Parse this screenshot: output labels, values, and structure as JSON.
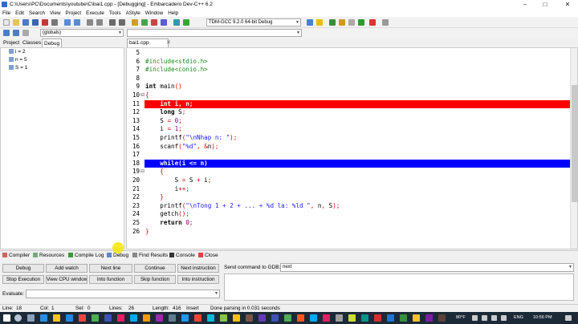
{
  "window": {
    "title": "C:\\Users\\PC\\Documents\\youtube\\C\\bai1.cpp - [Debugging] - Embarcadero Dev-C++ 6.2"
  },
  "menu": [
    "File",
    "Edit",
    "Search",
    "View",
    "Project",
    "Execute",
    "Tools",
    "AStyle",
    "Window",
    "Help"
  ],
  "toolbar": {
    "compiler_select": "TDM-GCC 9.2.0 64-bit Debug",
    "scope_select": "(globals)"
  },
  "left_tabs": [
    "Project",
    "Classes",
    "Debug"
  ],
  "watches": [
    "i = 2",
    "n = 5",
    "S = 1"
  ],
  "editor": {
    "tab_label": "bai1.cpp",
    "lines": [
      {
        "n": "5",
        "text": ""
      },
      {
        "n": "6",
        "text": "#include<stdio.h>"
      },
      {
        "n": "7",
        "text": "#include<conio.h>"
      },
      {
        "n": "8",
        "text": ""
      },
      {
        "n": "9",
        "text": "int main()"
      },
      {
        "n": "10",
        "text": "{"
      },
      {
        "n": "11",
        "text": "    int i, n;"
      },
      {
        "n": "12",
        "text": "    long S;"
      },
      {
        "n": "13",
        "text": "    S = 0;"
      },
      {
        "n": "14",
        "text": "    i = 1;"
      },
      {
        "n": "15",
        "text": "    printf(\"\\nNhap n: \");"
      },
      {
        "n": "16",
        "text": "    scanf(\"%d\", &n);"
      },
      {
        "n": "17",
        "text": ""
      },
      {
        "n": "18",
        "text": "    while(i <= n)"
      },
      {
        "n": "19",
        "text": "    {"
      },
      {
        "n": "20",
        "text": "        S = S + i;"
      },
      {
        "n": "21",
        "text": "        i++;"
      },
      {
        "n": "22",
        "text": "    }"
      },
      {
        "n": "23",
        "text": "    printf(\"\\nTong 1 + 2 + ... + %d la: %ld \", n, S);"
      },
      {
        "n": "24",
        "text": "    getch();"
      },
      {
        "n": "25",
        "text": "    return 0;"
      },
      {
        "n": "26",
        "text": "}"
      }
    ]
  },
  "bottom_tabs": [
    "Compiler",
    "Resources",
    "Compile Log",
    "Debug",
    "Find Results",
    "Console",
    "Close"
  ],
  "debug": {
    "buttons_row1": [
      "Debug",
      "Add watch",
      "Next line",
      "Continue",
      "Next instruction"
    ],
    "buttons_row2": [
      "Stop Execution",
      "View CPU window",
      "Into function",
      "Skip function",
      "Into instruction"
    ],
    "gdb_label": "Send command to GDB:",
    "gdb_value": "next",
    "evaluate_label": "Evaluate:"
  },
  "status": {
    "line_label": "Line:",
    "line": "18",
    "col_label": "Col:",
    "col": "1",
    "sel_label": "Sel:",
    "sel": "0",
    "lines_label": "Lines:",
    "lines": "26",
    "length_label": "Length:",
    "length": "416",
    "mode": "Insert",
    "message": "Done parsing in 0.031 seconds"
  },
  "taskbar": {
    "temp": "80°F",
    "lang": "ENG",
    "time": "10:56 PM"
  },
  "colors": {
    "breakpoint": "#ff0000",
    "current_line": "#0000ff"
  }
}
